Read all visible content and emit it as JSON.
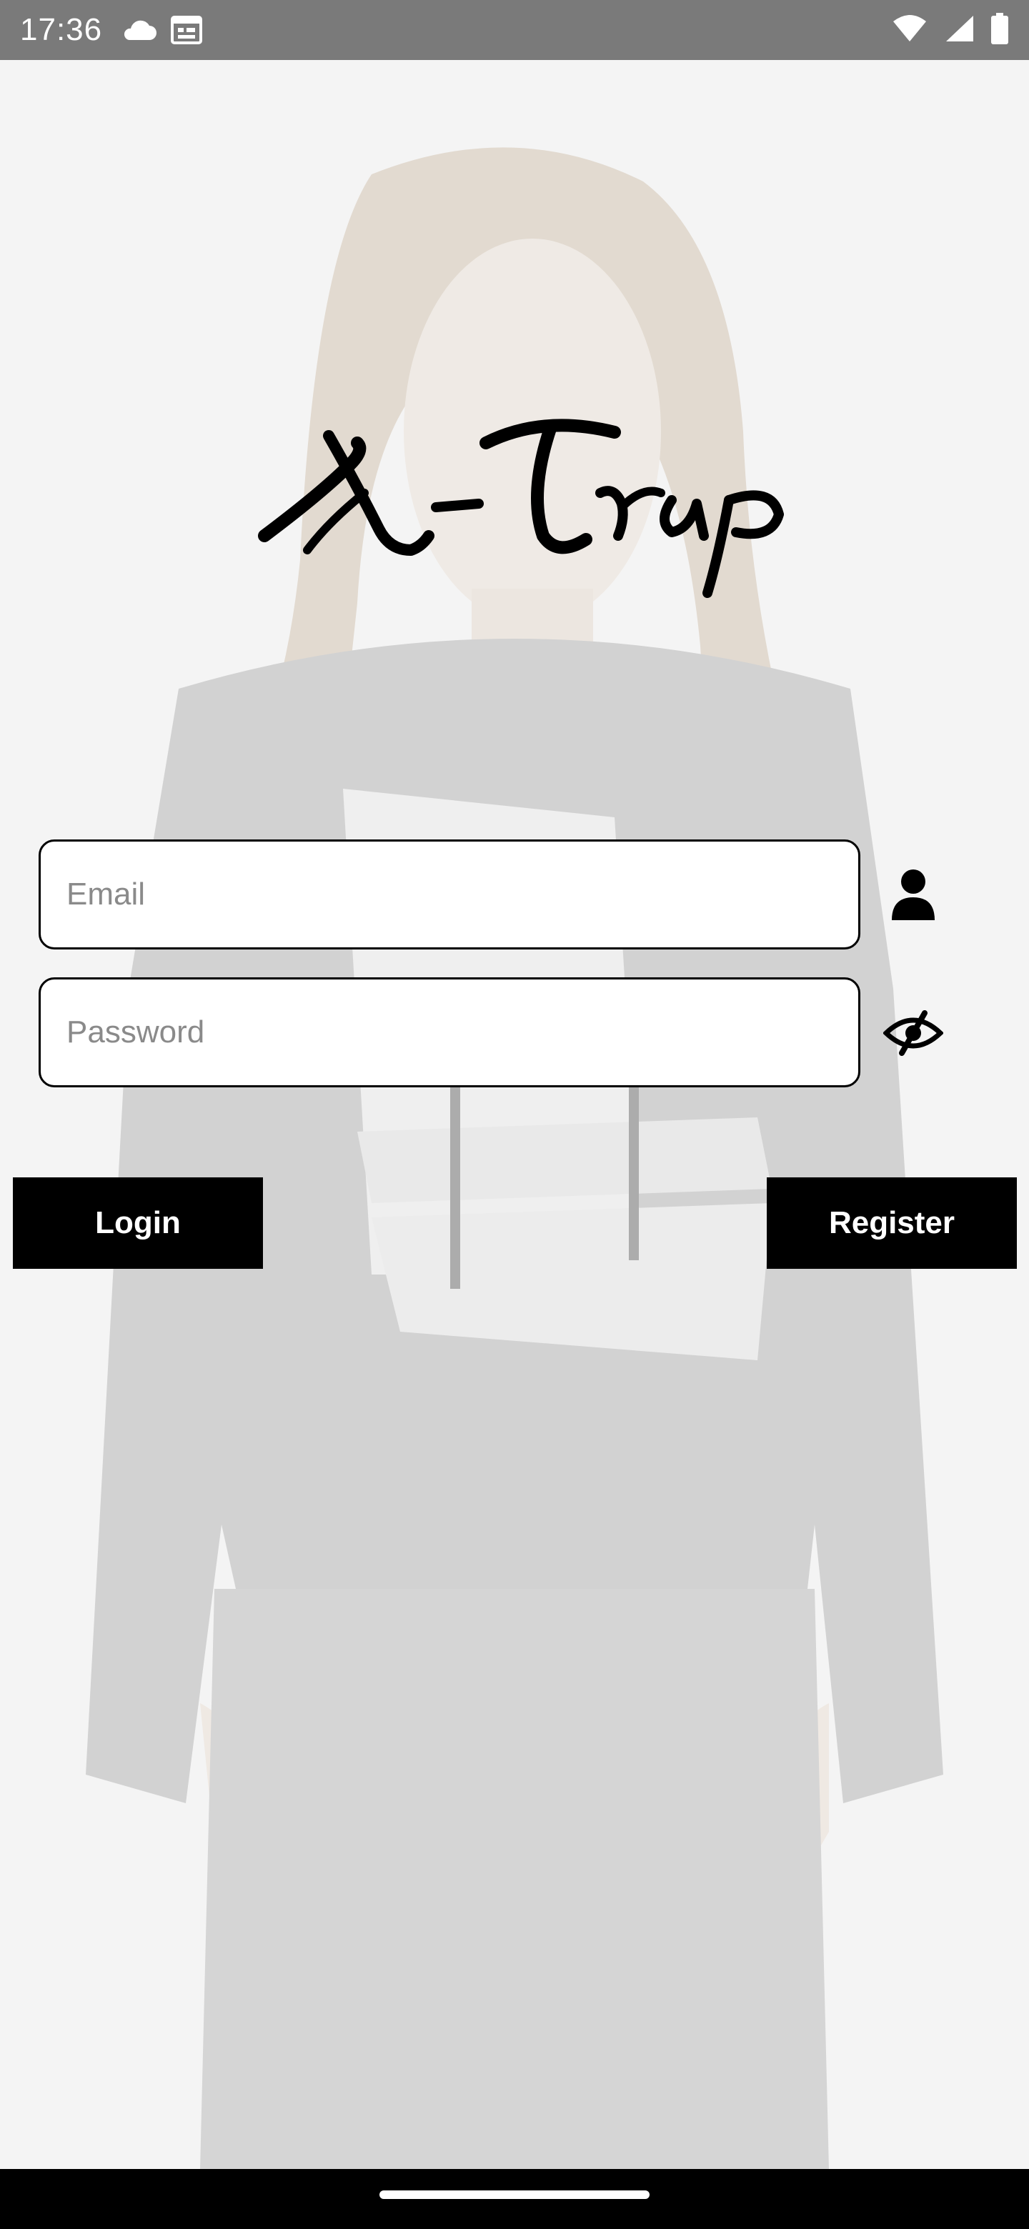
{
  "status_bar": {
    "time": "17:36",
    "left_icons": [
      "cloud-icon",
      "calendar-icon"
    ],
    "right_icons": [
      "wifi-icon",
      "signal-icon",
      "battery-icon"
    ]
  },
  "logo": {
    "text": "X-Trap"
  },
  "form": {
    "email": {
      "placeholder": "Email",
      "value": "",
      "icon": "user-icon"
    },
    "password": {
      "placeholder": "Password",
      "value": "",
      "icon": "eye-slash-icon"
    }
  },
  "actions": {
    "login_label": "Login",
    "register_label": "Register"
  },
  "colors": {
    "status_bar": "#7a7a7a",
    "button_bg": "#000000",
    "button_text": "#ffffff",
    "field_border": "#000000",
    "nav_bar": "#000000"
  }
}
